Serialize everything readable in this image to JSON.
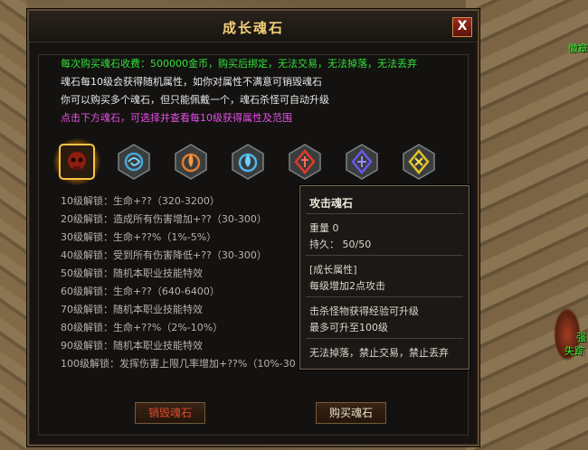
{
  "scene": {
    "npc_top": "徽章",
    "npc_mid1": "强",
    "npc_mid2": "失踪"
  },
  "dialog": {
    "title": "成长魂石",
    "close_label": "X",
    "info": [
      "每次购买魂石收费：500000金币，购买后绑定，无法交易，无法掉落，无法丢弃",
      "魂石每10级会获得随机属性，如你对属性不满意可销毁魂石",
      "你可以购买多个魂石，但只能佩戴一个，魂石杀怪可自动升级",
      "点击下方魂石，可选择并查看每10级获得属性及范围"
    ],
    "stones": [
      {
        "type": "attack",
        "color": "#e03b1f",
        "icon": "skull-icon",
        "selected": true
      },
      {
        "type": "swirl",
        "color": "#47a8d8",
        "icon": "swirl-icon",
        "selected": false
      },
      {
        "type": "flame",
        "color": "#e57a2b",
        "icon": "flame-icon",
        "selected": false
      },
      {
        "type": "drop",
        "color": "#4fb6e9",
        "icon": "drop-icon",
        "selected": false
      },
      {
        "type": "rune-red",
        "color": "#e23a28",
        "icon": "rune-icon",
        "selected": false
      },
      {
        "type": "rune-purple",
        "color": "#6b56e8",
        "icon": "rune-icon",
        "selected": false
      },
      {
        "type": "rune-yellow",
        "color": "#e5c322",
        "icon": "rune-icon",
        "selected": false
      }
    ],
    "unlocks": [
      "10级解锁：生命+??（320-3200）",
      "20级解锁：造成所有伤害增加+??（30-300）",
      "30级解锁：生命+??%（1%-5%）",
      "40级解锁：受到所有伤害降低+??（30-300）",
      "50级解锁：随机本职业技能特效",
      "60级解锁：生命+??（640-6400）",
      "70级解锁：随机本职业技能特效",
      "80级解锁：生命+??%（2%-10%）",
      "90级解锁：随机本职业技能特效",
      "100级解锁：发挥伤害上限几率增加+??%（10%-30"
    ],
    "tooltip": {
      "name": "攻击魂石",
      "weight": "重量    0",
      "durability": "持久：  50/50",
      "attr_header": "[成长属性]",
      "attr_value": "每级增加2点攻击",
      "growth_1": "击杀怪物获得经验可升级",
      "growth_2": "最多可升至100级",
      "restriction": "无法掉落，禁止交易，禁止丢弃"
    },
    "buttons": {
      "destroy": "销毁魂石",
      "buy": "购买魂石"
    },
    "colors": {
      "title": "#f0cf7a",
      "green": "#32e13b",
      "pink": "#e64fe8",
      "destroy": "#e24a2c"
    }
  }
}
